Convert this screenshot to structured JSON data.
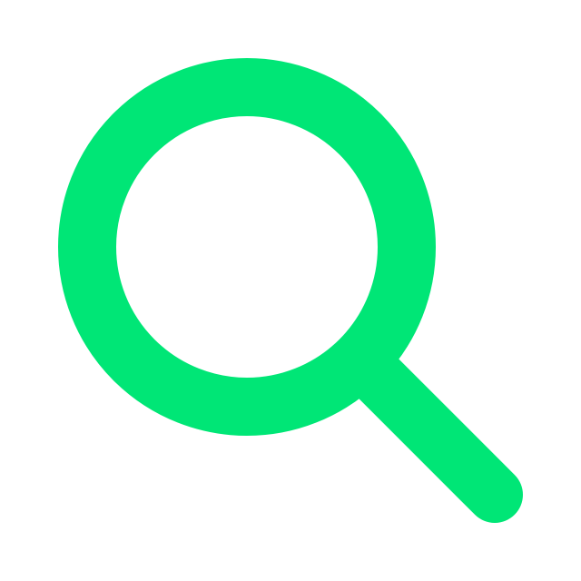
{
  "icon": {
    "name": "search-icon",
    "color": "#00E676",
    "background": "#FFFFFF"
  }
}
